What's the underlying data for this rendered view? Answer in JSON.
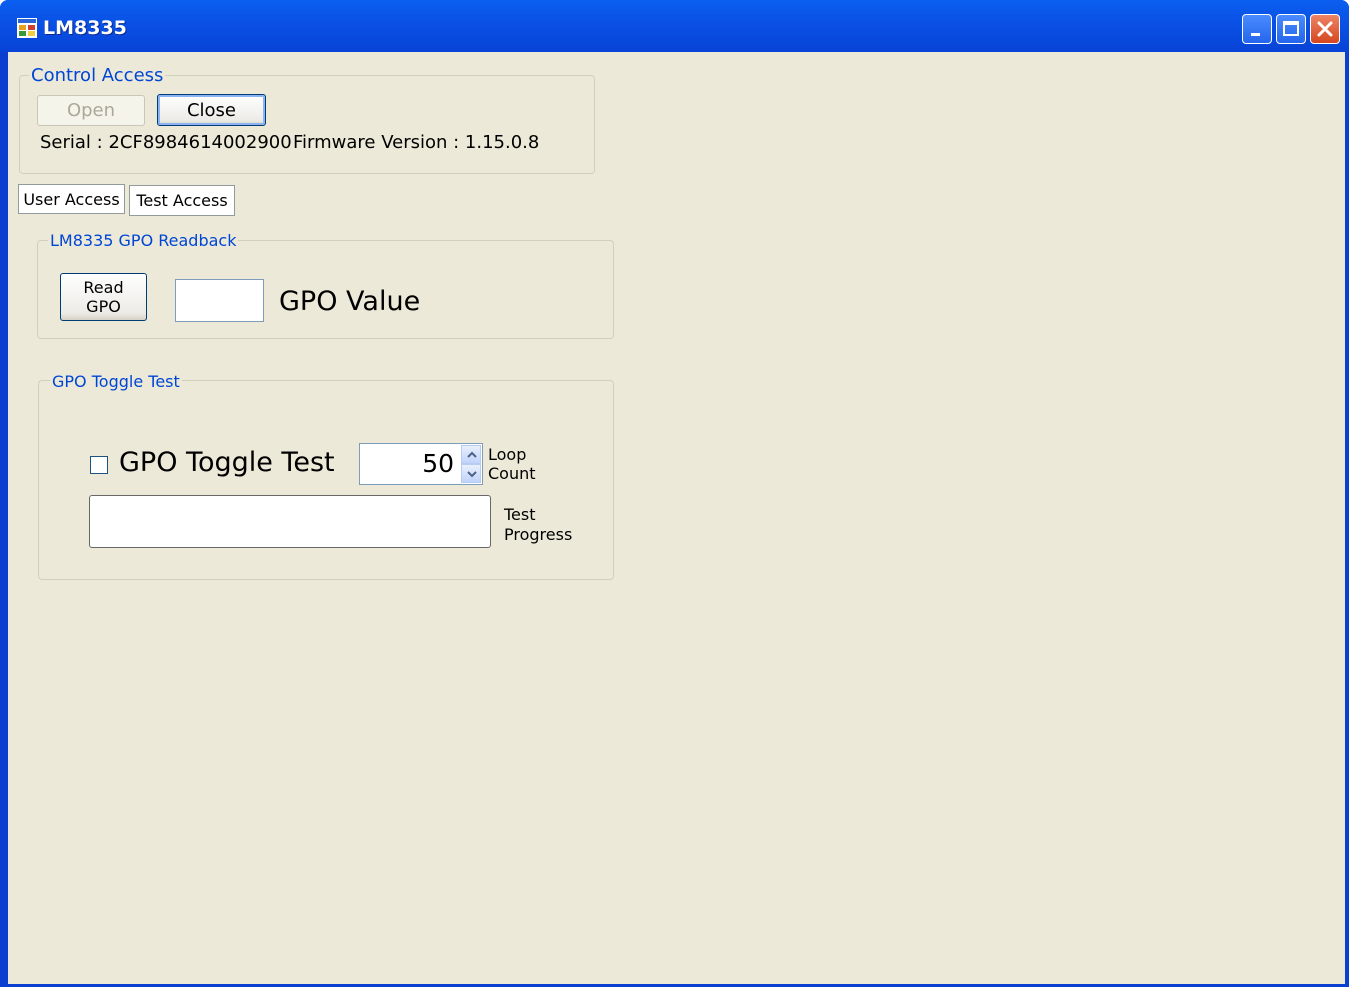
{
  "window": {
    "title": "LM8335",
    "icon": "app-window-icon",
    "controls": [
      "minimize-icon",
      "maximize-icon",
      "close-icon"
    ]
  },
  "control_access": {
    "label": "Control Access",
    "open_label": "Open",
    "close_label": "Close",
    "serial": "Serial : 2CF8984614002900",
    "firmware": "Firmware Version : 1.15.0.8"
  },
  "tabs": [
    {
      "label": "User Access"
    },
    {
      "label": "Test Access"
    }
  ],
  "gpo_readback": {
    "label": "LM8335 GPO Readback",
    "read_line1": "Read",
    "read_line2": "GPO",
    "value": "",
    "value_label": "GPO Value"
  },
  "gpo_toggle": {
    "label": "GPO Toggle Test",
    "checkbox_label": "GPO Toggle Test",
    "checked": false,
    "loop_count": "50",
    "loop_label_line1": "Loop",
    "loop_label_line2": "Count",
    "progress": 0,
    "progress_label_line1": "Test",
    "progress_label_line2": "Progress"
  },
  "colors": {
    "title_bar": "#0a52e6",
    "client_background": "#ece9d8",
    "group_label": "#0046d5"
  }
}
